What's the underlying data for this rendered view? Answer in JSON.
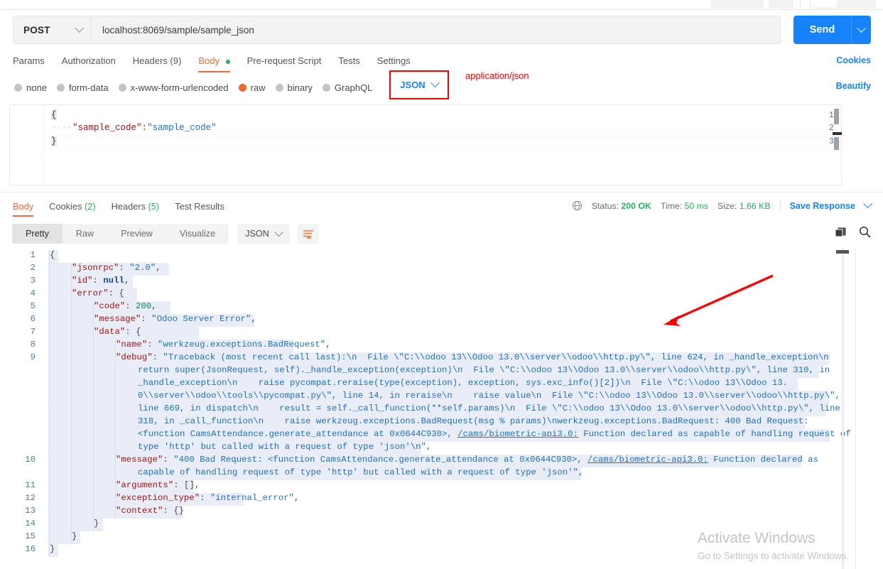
{
  "request": {
    "method": "POST",
    "url": "localhost:8069/sample/sample_json",
    "send_label": "Send",
    "tabs": [
      {
        "label": "Params"
      },
      {
        "label": "Authorization"
      },
      {
        "label": "Headers (9)"
      },
      {
        "label": "Body"
      },
      {
        "label": "Pre-request Script"
      },
      {
        "label": "Tests"
      },
      {
        "label": "Settings"
      }
    ],
    "cookies_link": "Cookies",
    "beautify_link": "Beautify",
    "body_types": [
      {
        "label": "none"
      },
      {
        "label": "form-data"
      },
      {
        "label": "x-www-form-urlencoded"
      },
      {
        "label": "raw"
      },
      {
        "label": "binary"
      },
      {
        "label": "GraphQL"
      }
    ],
    "format_selected": "JSON",
    "annotation": "application/json",
    "editor": {
      "line_numbers": [
        "1",
        "2",
        "3"
      ],
      "line1_brace": "{",
      "line2_indent": "····",
      "line2_key": "\"sample_code\"",
      "line2_colon": ":",
      "line2_value": "\"sample_code\"",
      "line3_brace": "}"
    }
  },
  "response": {
    "tabs": [
      {
        "label": "Body",
        "count": ""
      },
      {
        "label": "Cookies ",
        "count": "(2)"
      },
      {
        "label": "Headers ",
        "count": "(5)"
      },
      {
        "label": "Test Results",
        "count": ""
      }
    ],
    "status_label": "Status:",
    "status_value": "200 OK",
    "time_label": "Time:",
    "time_value": "50 ms",
    "size_label": "Size:",
    "size_value": "1.66 KB",
    "save_response": "Save Response",
    "view_modes": [
      {
        "label": "Pretty"
      },
      {
        "label": "Raw"
      },
      {
        "label": "Preview"
      },
      {
        "label": "Visualize"
      }
    ],
    "format_selected": "JSON",
    "line_numbers": [
      "1",
      "2",
      "3",
      "4",
      "5",
      "6",
      "7",
      "8",
      "9",
      "10",
      "11",
      "12",
      "13",
      "14",
      "15",
      "16"
    ],
    "json": {
      "l1": "{",
      "l2_key": "\"jsonrpc\"",
      "l2_val": "\"2.0\"",
      "l3_key": "\"id\"",
      "l3_val": "null",
      "l4_key": "\"error\"",
      "l5_key": "\"code\"",
      "l5_val": "200",
      "l6_key": "\"message\"",
      "l6_val": "\"Odoo Server Error\"",
      "l7_key": "\"data\"",
      "l8_key": "\"name\"",
      "l8_val": "\"werkzeug.exceptions.BadRequest\"",
      "l9_key": "\"debug\"",
      "l9_a": "\"Traceback (most recent call last):\\n  File \\\"C:\\\\odoo 13\\\\Odoo 13.0\\\\server\\\\odoo\\\\http.py\\\", line 624, in _handle_exception\\n",
      "l9_b": "return super(JsonRequest, self)._handle_exception(exception)\\n  File \\\"C:\\\\odoo 13\\\\Odoo 13.0\\\\server\\\\odoo\\\\http.py\\\", line 310, in",
      "l9_c": "_handle_exception\\n    raise pycompat.reraise(type(exception), exception, sys.exc_info()[2])\\n  File \\\"C:\\\\odoo 13\\\\Odoo 13.",
      "l9_d": "0\\\\server\\\\odoo\\\\tools\\\\pycompat.py\\\", line 14, in reraise\\n    raise value\\n  File \\\"C:\\\\odoo 13\\\\Odoo 13.0\\\\server\\\\odoo\\\\http.py\\\",",
      "l9_e": "line 669, in dispatch\\n    result = self._call_function(**self.params)\\n  File \\\"C:\\\\odoo 13\\\\Odoo 13.0\\\\server\\\\odoo\\\\http.py\\\", line",
      "l9_f": "318, in _call_function\\n    raise werkzeug.exceptions.BadRequest(msg % params)\\nwerkzeug.exceptions.BadRequest: 400 Bad Request:",
      "l9_g1": "<function CamsAttendance.generate_attendance at 0x0644C930>, ",
      "l9_g2": "/cams/biometric-api3.0:",
      "l9_g3": " Function declared as capable of handling request of",
      "l9_h": "type 'http' but called with a request of type 'json'\\n\",",
      "l10_key": "\"message\"",
      "l10_a": "\"400 Bad Request: <function CamsAttendance.generate_attendance at 0x0644C930>, ",
      "l10_b": "/cams/biometric-api3.0:",
      "l10_c": " Function declared as",
      "l10_d": "capable of handling request of type 'http' but called with a request of type 'json'\",",
      "l11_key": "\"arguments\"",
      "l11_val": "[],",
      "l12_key": "\"exception_type\"",
      "l12_val": "\"internal_error\"",
      "l13_key": "\"context\"",
      "l13_val": "{}",
      "l14": "}",
      "l15": "}",
      "l16": "}"
    }
  },
  "watermark": {
    "title": "Activate Windows",
    "subtitle": "Go to Settings to activate Windows."
  },
  "icons": {
    "globe": "globe-icon",
    "copy": "copy-icon",
    "search": "search-icon",
    "wrap": "wrap-lines-icon"
  },
  "colors": {
    "accent_orange": "#f26b3a",
    "link_blue": "#1683fb",
    "send_blue": "#1683fb",
    "success_green": "#27ae60",
    "annotation_red": "#ff0000",
    "json_key": "#a31515",
    "json_string": "#1f6fc4",
    "json_number": "#098658",
    "highlight_bg": "#e8edf7"
  }
}
